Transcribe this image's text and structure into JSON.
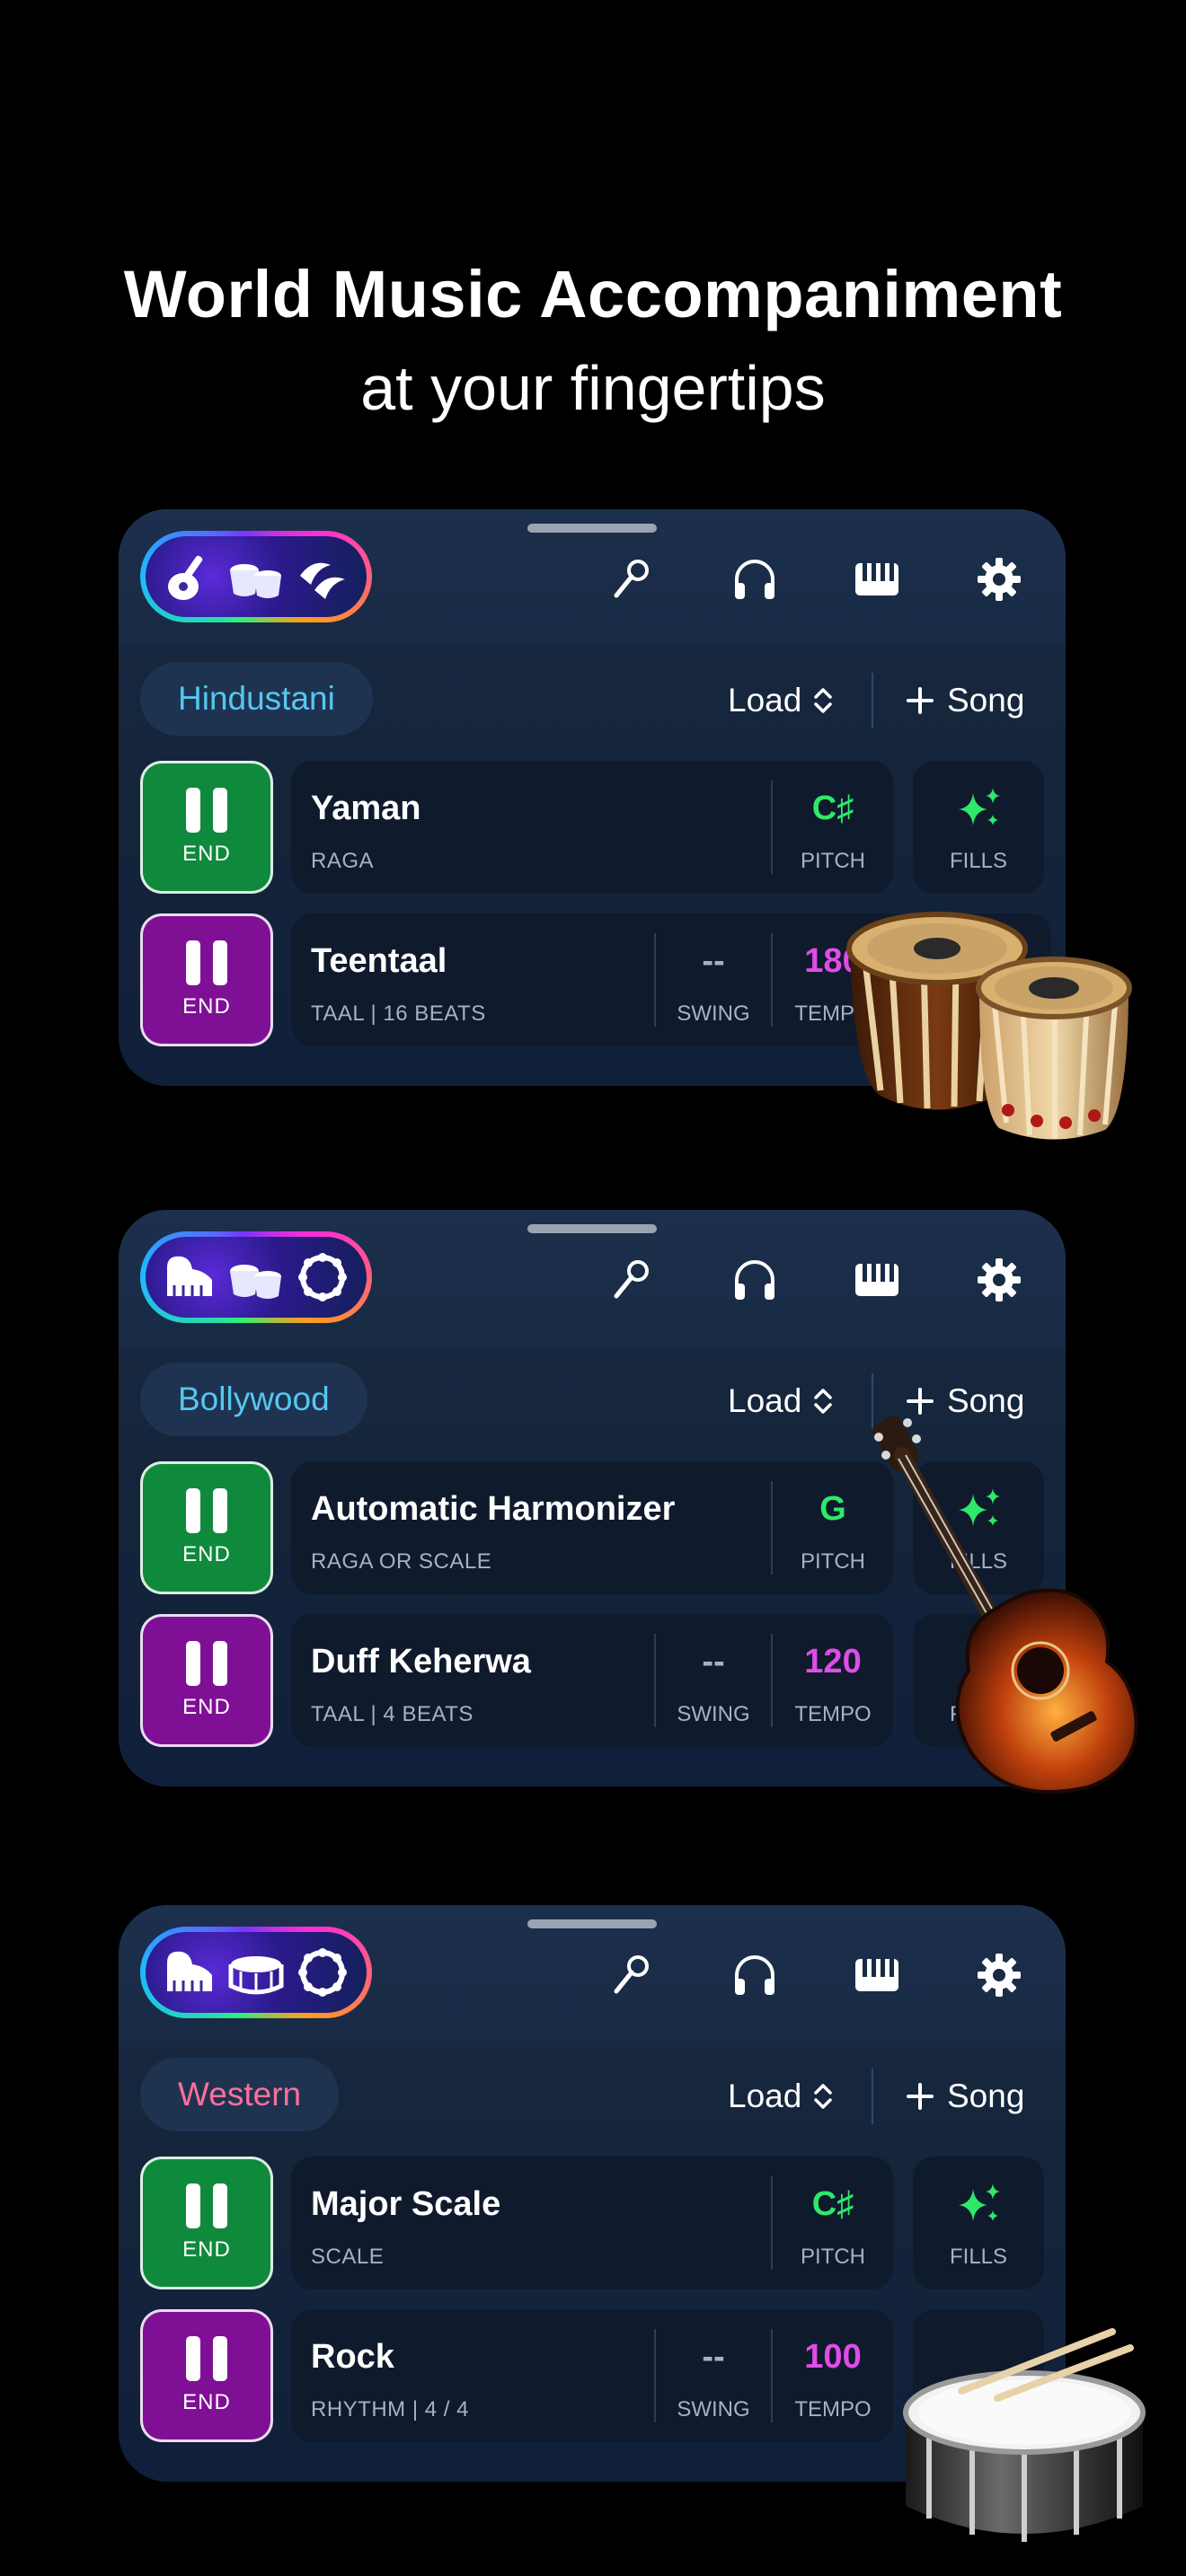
{
  "headline": {
    "line1": "World Music Accompaniment",
    "line2": "at your fingertips"
  },
  "colors": {
    "background": "#000000",
    "panel": "#15253b",
    "card": "#0f1a2c",
    "green_button": "#0f8a3c",
    "purple_button": "#7f1095",
    "pitch_green": "#2ee86a",
    "tempo_magenta": "#e14ce8",
    "fills_green": "#2ee86a",
    "genre_cyan": "#56c7f0",
    "genre_pink": "#ff6f9a"
  },
  "toolbar": {
    "icons": [
      "microphone-icon",
      "headphones-icon",
      "keyboard-icon",
      "gear-icon"
    ]
  },
  "panels": [
    {
      "instruments": [
        "sitar-icon",
        "tabla-icon",
        "cymbals-icon"
      ],
      "genre": "Hindustani",
      "genre_color": "#56c7f0",
      "load_label": "Load",
      "song_label": "Song",
      "row1": {
        "button_label": "END",
        "title": "Yaman",
        "subtitle": "RAGA",
        "pitch_value": "C♯",
        "pitch_label": "PITCH",
        "fills_label": "FILLS"
      },
      "row2": {
        "button_label": "END",
        "title": "Teentaal",
        "subtitle": "TAAL | 16 BEATS",
        "swing_value": "--",
        "swing_label": "SWING",
        "tempo_value": "180",
        "tempo_label": "TEMPO"
      },
      "decoration": "tabla-drums-image"
    },
    {
      "instruments": [
        "piano-icon",
        "tabla-icon",
        "tambourine-icon"
      ],
      "genre": "Bollywood",
      "genre_color": "#56c7f0",
      "load_label": "Load",
      "song_label": "Song",
      "row1": {
        "button_label": "END",
        "title": "Automatic Harmonizer",
        "subtitle": "RAGA OR SCALE",
        "pitch_value": "G",
        "pitch_label": "PITCH",
        "fills_label": "FILLS"
      },
      "row2": {
        "button_label": "END",
        "title": "Duff Keherwa",
        "subtitle": "TAAL | 4 BEATS",
        "swing_value": "--",
        "swing_label": "SWING",
        "tempo_value": "120",
        "tempo_label": "TEMPO",
        "fills_label": "FILLS"
      },
      "decoration": "acoustic-guitar-image"
    },
    {
      "instruments": [
        "piano-icon",
        "snare-drum-icon",
        "tambourine-icon"
      ],
      "genre": "Western",
      "genre_color": "#ff6f9a",
      "load_label": "Load",
      "song_label": "Song",
      "row1": {
        "button_label": "END",
        "title": "Major Scale",
        "subtitle": "SCALE",
        "pitch_value": "C♯",
        "pitch_label": "PITCH",
        "fills_label": "FILLS"
      },
      "row2": {
        "button_label": "END",
        "title": "Rock",
        "subtitle": "RHYTHM | 4 / 4",
        "swing_value": "--",
        "swing_label": "SWING",
        "tempo_value": "100",
        "tempo_label": "TEMPO"
      },
      "decoration": "snare-drum-with-sticks-image"
    }
  ]
}
